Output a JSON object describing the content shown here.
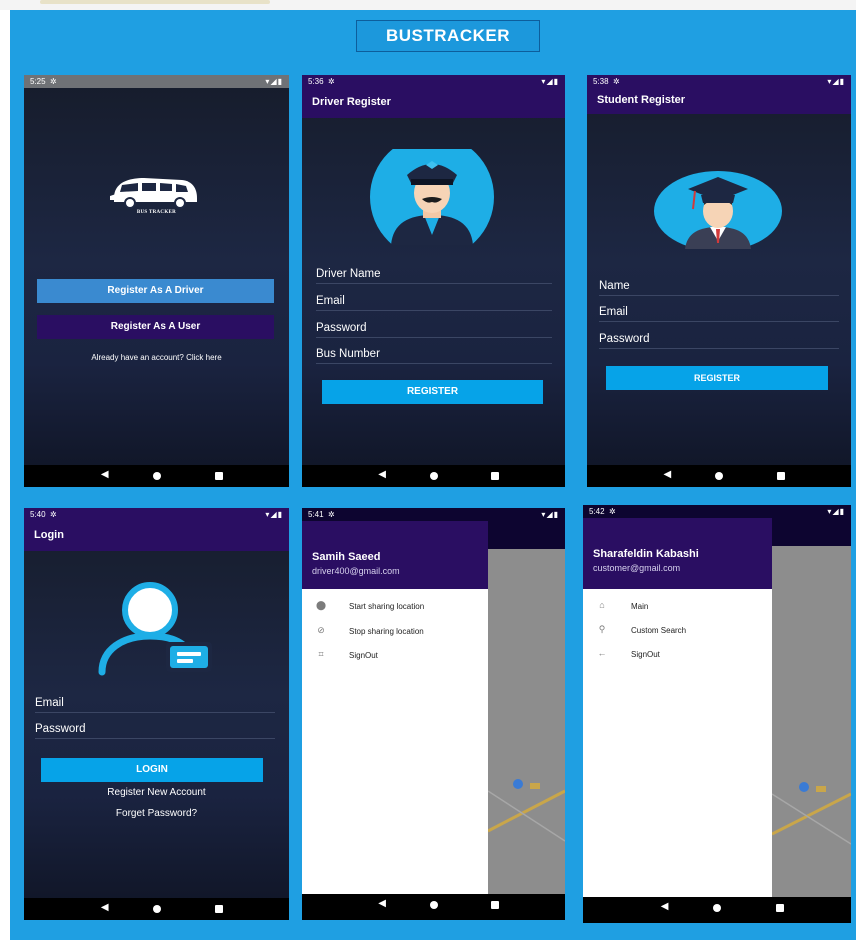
{
  "header": {
    "title": "BUSTRACKER"
  },
  "colors": {
    "frame": "#1f9fe2",
    "appbar": "#2a0e62",
    "accent": "#06a3e8"
  },
  "screen1": {
    "time": "5:25",
    "logo_text": "BUS TRACKER",
    "register_driver_label": "Register As A Driver",
    "register_user_label": "Register As A User",
    "login_link": "Already have an account? Click here"
  },
  "screen2": {
    "time": "5:36",
    "title": "Driver Register",
    "fields": [
      "Driver Name",
      "Email",
      "Password",
      "Bus Number"
    ],
    "register_label": "REGISTER"
  },
  "screen3": {
    "time": "5:38",
    "title": "Student Register",
    "fields": [
      "Name",
      "Email",
      "Password"
    ],
    "register_label": "REGISTER"
  },
  "screen4": {
    "time": "5:40",
    "title": "Login",
    "fields": [
      "Email",
      "Password"
    ],
    "login_label": "LOGIN",
    "register_link": "Register New Account",
    "forgot_link": "Forget Password?"
  },
  "screen5": {
    "time": "5:41",
    "user_name": "Samih Saeed",
    "user_email": "driver400@gmail.com",
    "menu": [
      {
        "icon": "location-pin-icon",
        "label": "Start sharing location"
      },
      {
        "icon": "location-off-icon",
        "label": "Stop sharing location"
      },
      {
        "icon": "crop-icon",
        "label": "SignOut"
      }
    ]
  },
  "screen6": {
    "time": "5:42",
    "user_name": "Sharafeldin Kabashi",
    "user_email": "customer@gmail.com",
    "menu": [
      {
        "icon": "home-icon",
        "label": "Main"
      },
      {
        "icon": "search-icon",
        "label": "Custom Search"
      },
      {
        "icon": "arrow-left-icon",
        "label": "SignOut"
      }
    ]
  }
}
